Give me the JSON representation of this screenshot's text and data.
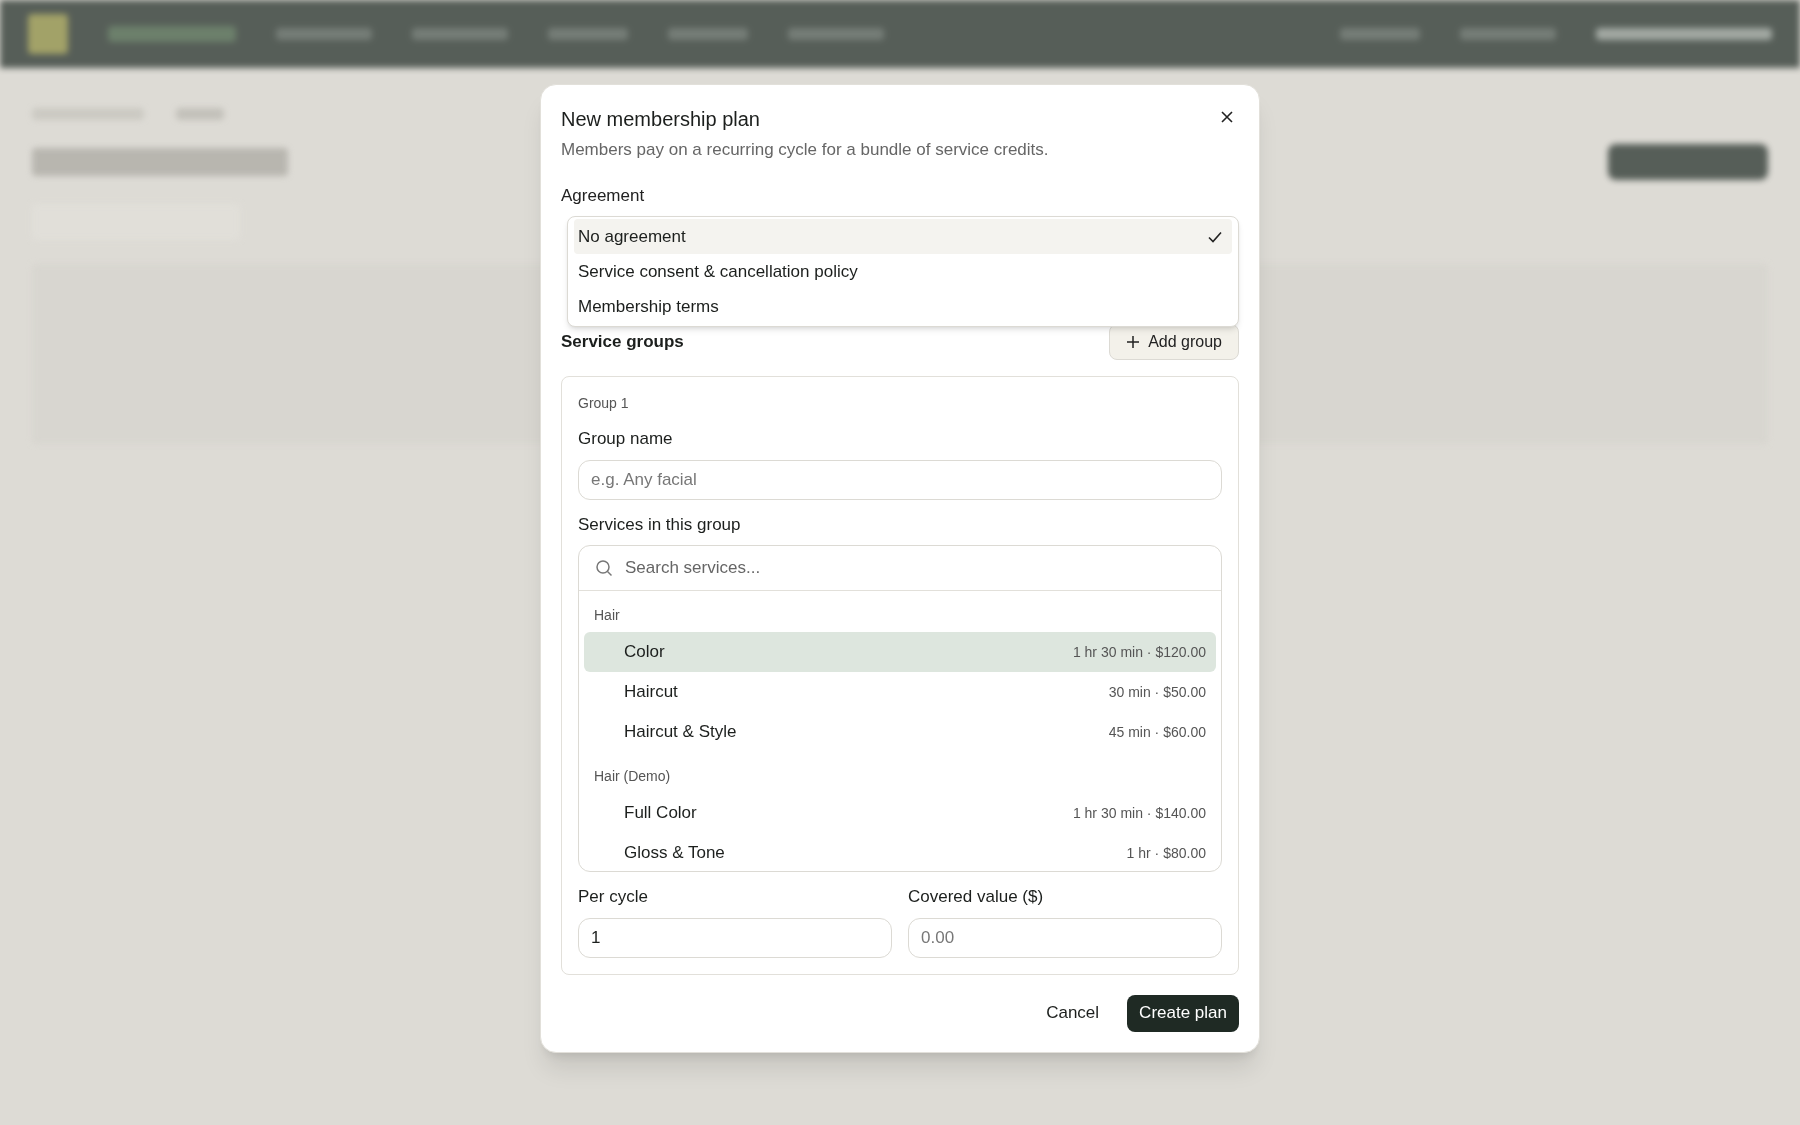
{
  "dialog": {
    "title": "New membership plan",
    "description": "Members pay on a recurring cycle for a bundle of service credits."
  },
  "agreement": {
    "label": "Agreement",
    "options": [
      {
        "label": "No agreement",
        "selected": true
      },
      {
        "label": "Service consent & cancellation policy",
        "selected": false
      },
      {
        "label": "Membership terms",
        "selected": false
      }
    ]
  },
  "service_groups": {
    "label": "Service groups",
    "add_button": "Add group",
    "groups": [
      {
        "heading": "Group 1",
        "name_label": "Group name",
        "name_placeholder": "e.g. Any facial",
        "services_label": "Services in this group",
        "search_placeholder": "Search services...",
        "categories": [
          {
            "name": "Hair",
            "services": [
              {
                "name": "Color",
                "detail": "1 hr 30 min · $120.00",
                "selected": true
              },
              {
                "name": "Haircut",
                "detail": "30 min · $50.00",
                "selected": false
              },
              {
                "name": "Haircut & Style",
                "detail": "45 min · $60.00",
                "selected": false
              }
            ]
          },
          {
            "name": "Hair (Demo)",
            "services": [
              {
                "name": "Full Color",
                "detail": "1 hr 30 min · $140.00",
                "selected": false
              },
              {
                "name": "Gloss & Tone",
                "detail": "1 hr · $80.00",
                "selected": false
              }
            ]
          }
        ],
        "per_cycle_label": "Per cycle",
        "per_cycle_value": "1",
        "covered_label": "Covered value ($)",
        "covered_placeholder": "0.00"
      }
    ]
  },
  "buttons": {
    "cancel": "Cancel",
    "create": "Create plan"
  }
}
